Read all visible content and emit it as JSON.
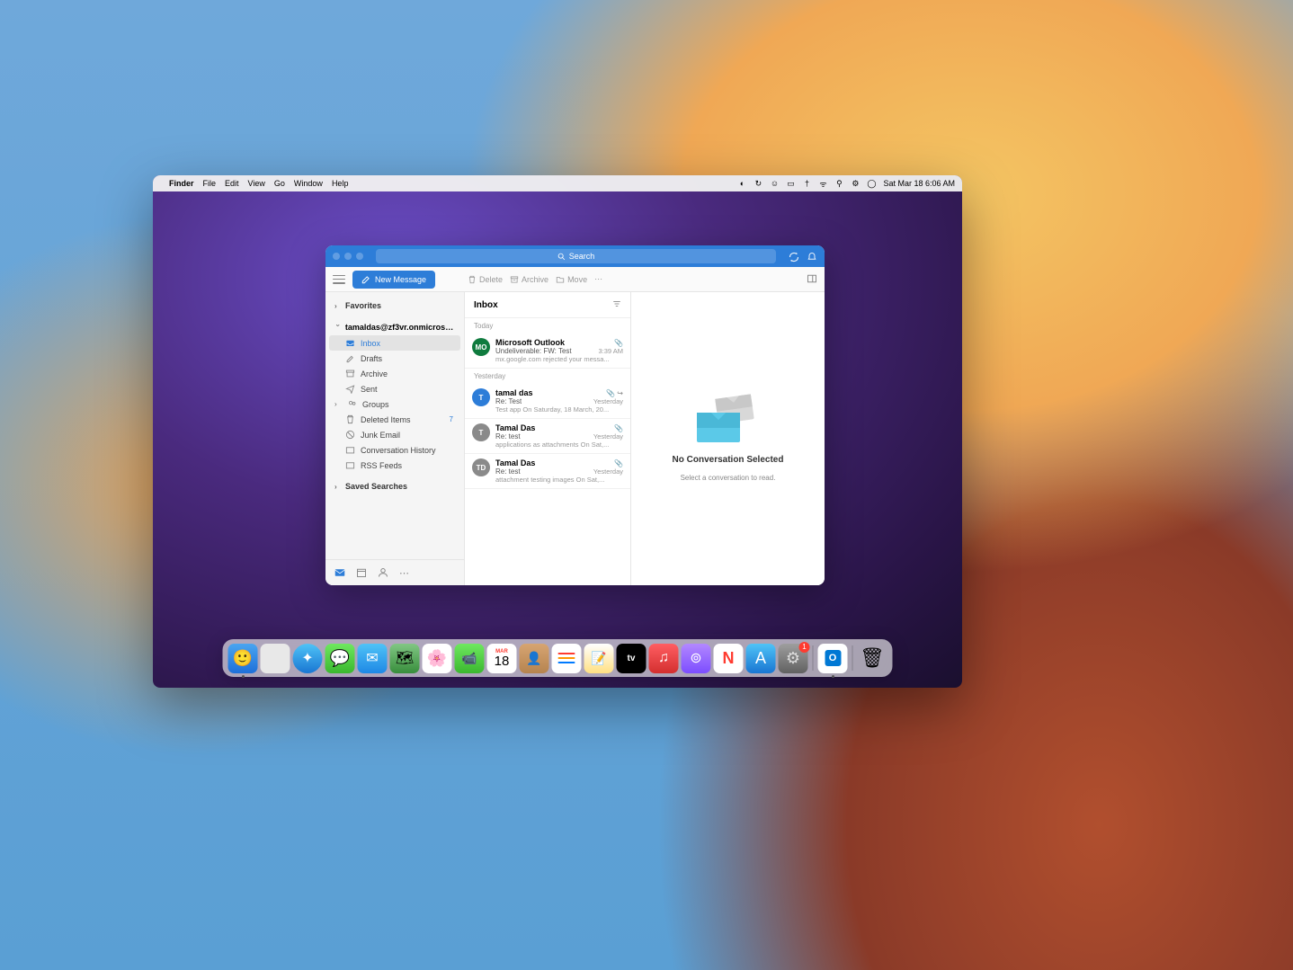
{
  "menubar": {
    "app": "Finder",
    "items": [
      "File",
      "Edit",
      "View",
      "Go",
      "Window",
      "Help"
    ],
    "datetime": "Sat Mar 18  6:06 AM"
  },
  "outlook": {
    "search_placeholder": "Search",
    "toolbar": {
      "new_message": "New Message",
      "delete": "Delete",
      "archive": "Archive",
      "move": "Move"
    },
    "sidebar": {
      "favorites": "Favorites",
      "account": "tamaldas@zf3vr.onmicroso...",
      "folders": [
        {
          "label": "Inbox",
          "active": true
        },
        {
          "label": "Drafts"
        },
        {
          "label": "Archive"
        },
        {
          "label": "Sent"
        },
        {
          "label": "Groups",
          "chevron": true
        },
        {
          "label": "Deleted Items",
          "badge": "7"
        },
        {
          "label": "Junk Email"
        },
        {
          "label": "Conversation History"
        },
        {
          "label": "RSS Feeds"
        }
      ],
      "saved_searches": "Saved Searches"
    },
    "msglist": {
      "title": "Inbox",
      "groups": [
        {
          "label": "Today",
          "messages": [
            {
              "avatar": "MO",
              "avatar_color": "#0f7b3e",
              "sender": "Microsoft Outlook",
              "subject": "Undeliverable: FW: Test",
              "time": "3:39 AM",
              "preview": "mx.google.com rejected your messa...",
              "attach": true
            }
          ]
        },
        {
          "label": "Yesterday",
          "messages": [
            {
              "avatar": "T",
              "avatar_color": "#2d7dd8",
              "sender": "tamal das",
              "subject": "Re: Test",
              "time": "Yesterday",
              "preview": "Test app On Saturday, 18 March, 20...",
              "attach": true,
              "forward": true
            },
            {
              "avatar": "T",
              "avatar_color": "#8a8a8a",
              "sender": "Tamal Das",
              "subject": "Re: test",
              "time": "Yesterday",
              "preview": "applications as attachments On Sat,...",
              "attach": true
            },
            {
              "avatar": "TD",
              "avatar_color": "#8a8a8a",
              "sender": "Tamal Das",
              "subject": "Re: test",
              "time": "Yesterday",
              "preview": "attachment testing images On Sat,...",
              "attach": true
            }
          ]
        }
      ]
    },
    "reading_pane": {
      "title": "No Conversation Selected",
      "subtitle": "Select a conversation to read."
    }
  },
  "dock": {
    "calendar_day": "18",
    "calendar_month": "MAR",
    "settings_badge": "1"
  }
}
